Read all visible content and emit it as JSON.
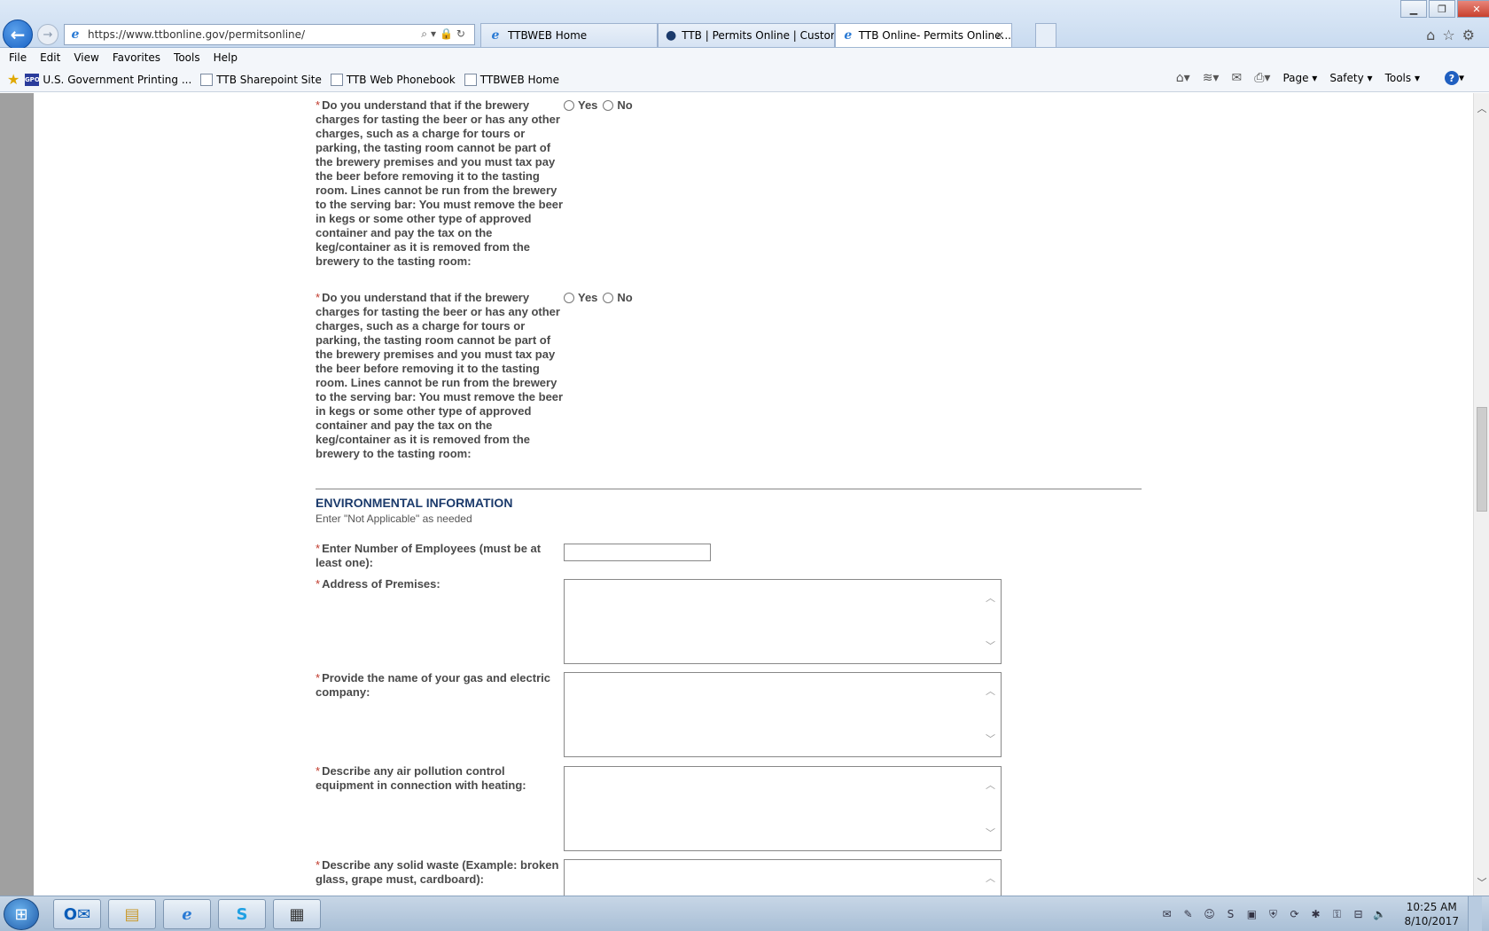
{
  "browser": {
    "url": "https://www.ttbonline.gov/permitsonline/",
    "tabs": [
      {
        "label": "TTBWEB Home",
        "active": false
      },
      {
        "label": "TTB | Permits Online | Custom...",
        "active": false
      },
      {
        "label": "TTB Online- Permits Online...",
        "active": true
      }
    ],
    "menu": [
      "File",
      "Edit",
      "View",
      "Favorites",
      "Tools",
      "Help"
    ],
    "favorites": [
      {
        "label": "U.S. Government Printing ...",
        "icon": "GPO"
      },
      {
        "label": "TTB Sharepoint Site"
      },
      {
        "label": "TTB Web Phonebook"
      },
      {
        "label": "TTBWEB Home"
      }
    ],
    "commands": [
      "Page ▾",
      "Safety ▾",
      "Tools ▾"
    ]
  },
  "form": {
    "questions": [
      {
        "required": "*",
        "text": "Do you understand that if the brewery charges for tasting the beer or has any other charges, such as a charge for tours or parking, the tasting room cannot be part of the brewery premises and you must tax pay the beer before removing it to the tasting room. Lines cannot be run from the brewery to the serving bar: You must remove the beer in kegs or some other type of approved container and pay the tax on the keg/container as it is removed from the brewery to the tasting room:",
        "yes": "Yes",
        "no": "No"
      },
      {
        "required": "*",
        "text": "Do you understand that if the brewery charges for tasting the beer or has any other charges, such as a charge for tours or parking, the tasting room cannot be part of the brewery premises and you must tax pay the beer before removing it to the tasting room. Lines cannot be run from the brewery to the serving bar: You must remove the beer in kegs or some other type of approved container and pay the tax on the keg/container as it is removed from the brewery to the tasting room:",
        "yes": "Yes",
        "no": "No"
      }
    ],
    "environmental": {
      "title": "ENVIRONMENTAL INFORMATION",
      "subtitle": "Enter \"Not Applicable\" as needed",
      "fields": [
        {
          "label": "Enter Number of Employees (must be at least one):",
          "value": ""
        },
        {
          "label": "Address of Premises:",
          "value": ""
        },
        {
          "label": "Provide the name of your gas and electric company:",
          "value": ""
        },
        {
          "label": "Describe any air pollution control equipment in connection with heating:",
          "value": ""
        },
        {
          "label": "Describe any solid waste (Example: broken glass, grape must, cardboard):",
          "value": ""
        }
      ]
    }
  },
  "taskbar": {
    "time": "10:25 AM",
    "date": "8/10/2017"
  }
}
